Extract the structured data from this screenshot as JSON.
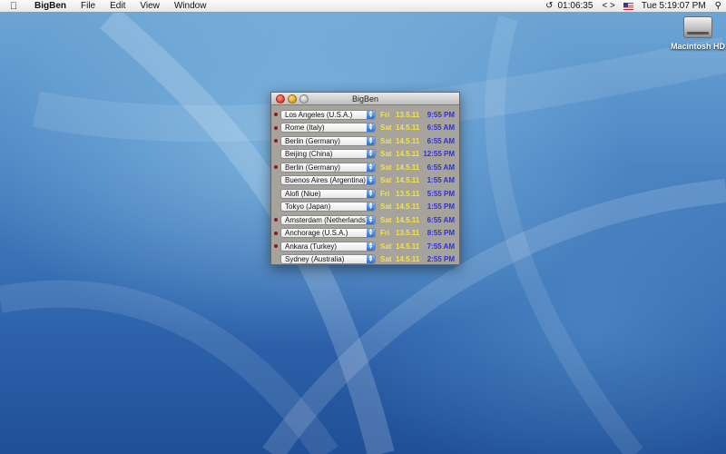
{
  "menubar": {
    "app_name": "BigBen",
    "menus": [
      "File",
      "Edit",
      "View",
      "Window"
    ],
    "timer": "01:06:35",
    "nav_arrows": "< >",
    "clock": "Tue 5:19:07 PM"
  },
  "desktop": {
    "hd_label": "Macintosh HD"
  },
  "window": {
    "title": "BigBen",
    "rows": [
      {
        "city": "Los Angeles (U.S.A.)",
        "day": "Fri",
        "date": "13.5.11",
        "time": "9:55 PM",
        "dot": true
      },
      {
        "city": "Rome (Italy)",
        "day": "Sat",
        "date": "14.5.11",
        "time": "6:55 AM",
        "dot": true
      },
      {
        "city": "Berlin (Germany)",
        "day": "Sat",
        "date": "14.5.11",
        "time": "6:55 AM",
        "dot": true
      },
      {
        "city": "Beijing (China)",
        "day": "Sat",
        "date": "14.5.11",
        "time": "12:55 PM",
        "dot": false
      },
      {
        "city": "Berlin (Germany)",
        "day": "Sat",
        "date": "14.5.11",
        "time": "6:55 AM",
        "dot": true
      },
      {
        "city": "Buenos Aires (Argentina)",
        "day": "Sat",
        "date": "14.5.11",
        "time": "1:55 AM",
        "dot": false
      },
      {
        "city": "Alofi (Niue)",
        "day": "Fri",
        "date": "13.5.11",
        "time": "5:55 PM",
        "dot": false
      },
      {
        "city": "Tokyo (Japan)",
        "day": "Sat",
        "date": "14.5.11",
        "time": "1:55 PM",
        "dot": false
      },
      {
        "city": "Amsterdam (Netherlands)",
        "day": "Sat",
        "date": "14.5.11",
        "time": "6:55 AM",
        "dot": true
      },
      {
        "city": "Anchorage (U.S.A.)",
        "day": "Fri",
        "date": "13.5.11",
        "time": "8:55 PM",
        "dot": true
      },
      {
        "city": "Ankara (Turkey)",
        "day": "Sat",
        "date": "14.5.11",
        "time": "7:55 AM",
        "dot": true
      },
      {
        "city": "Sydney (Australia)",
        "day": "Sat",
        "date": "14.5.11",
        "time": "2:55 PM",
        "dot": false
      }
    ]
  },
  "colors": {
    "day_date": "#f3e34a",
    "time": "#2f2fe0",
    "dot": "#8b1a1a",
    "window_bg": "#a6a39c"
  }
}
